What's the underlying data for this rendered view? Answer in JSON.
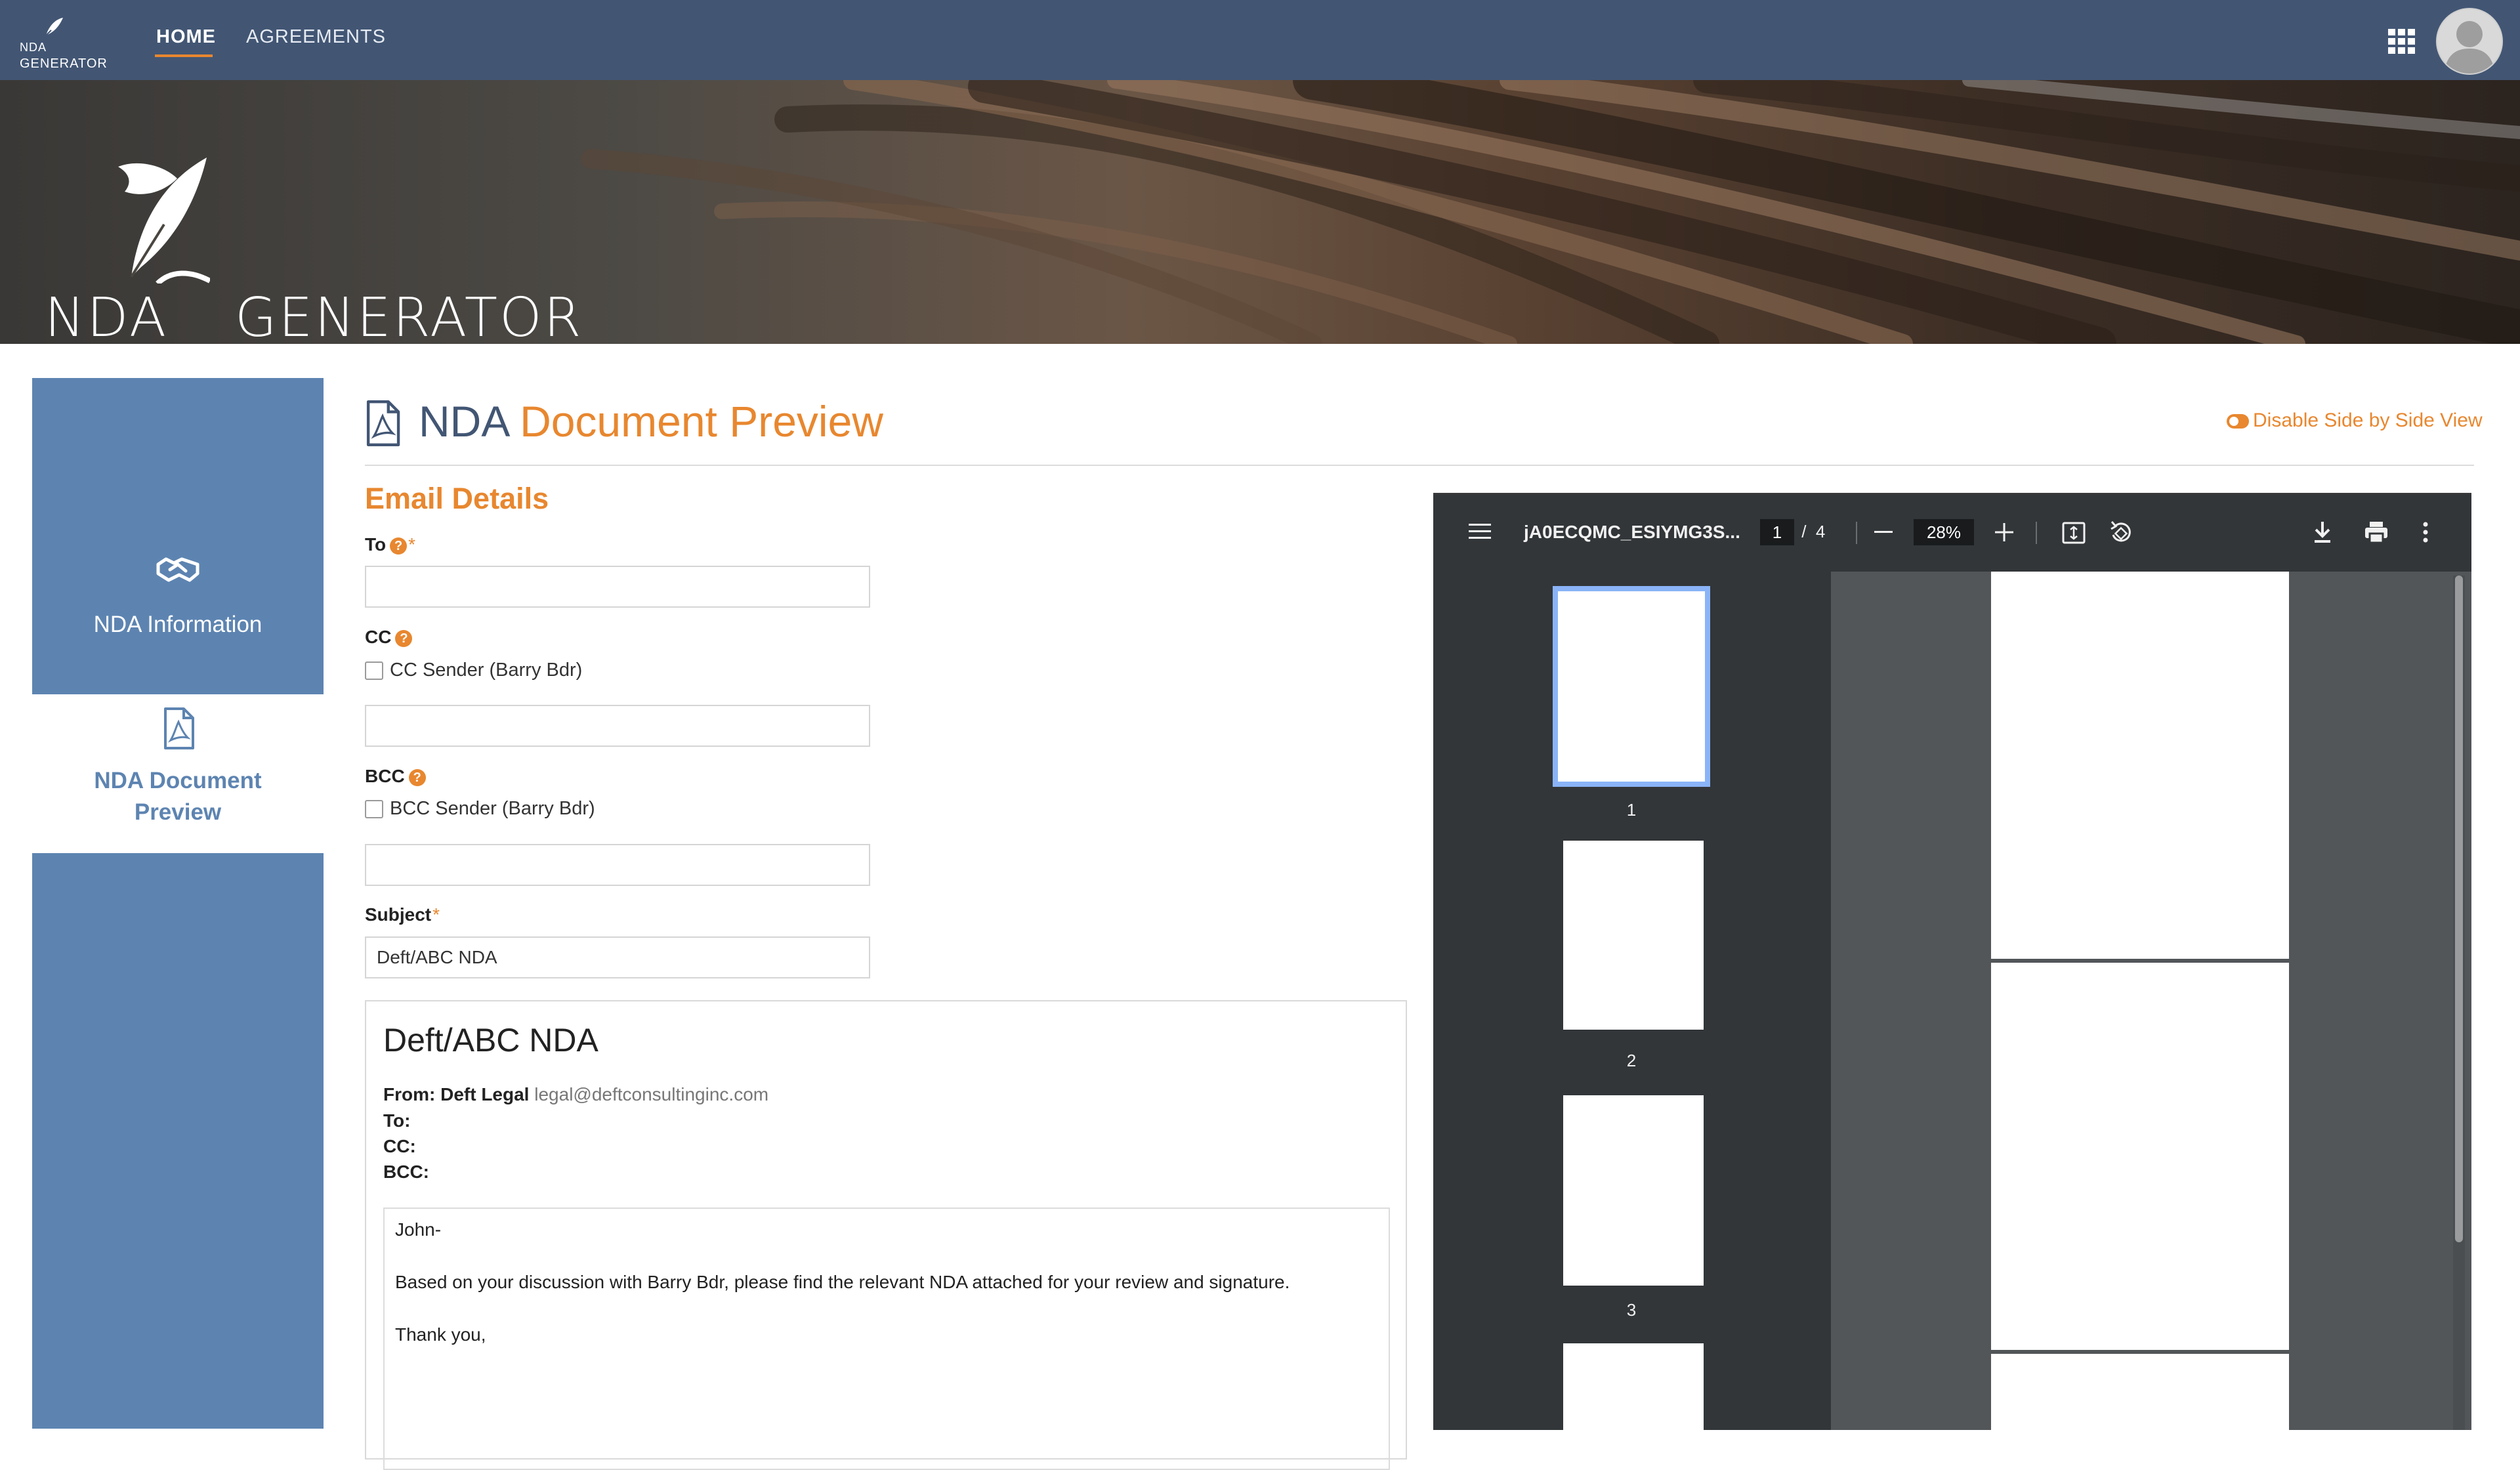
{
  "nav": {
    "logo_line1": "NDA",
    "logo_line2": "GENERATOR",
    "links": [
      {
        "label": "HOME"
      },
      {
        "label": "AGREEMENTS"
      }
    ]
  },
  "banner": {
    "brand_left": "NDA",
    "brand_right": "GENERATOR"
  },
  "sidebar": {
    "items": [
      {
        "label": "NDA Information"
      },
      {
        "label": "NDA Document Preview"
      }
    ]
  },
  "page": {
    "title_part1": "NDA",
    "title_part2": "Document Preview",
    "toggle_label": "Disable Side by Side View"
  },
  "form": {
    "section_title": "Email Details",
    "to_label": "To",
    "to_value": "",
    "cc_label": "CC",
    "cc_checkbox_label": "CC Sender (Barry Bdr)",
    "cc_value": "",
    "bcc_label": "BCC",
    "bcc_checkbox_label": "BCC Sender (Barry Bdr)",
    "bcc_value": "",
    "subject_label": "Subject",
    "subject_value": "Deft/ABC NDA",
    "help_glyph": "?",
    "required_mark": "*"
  },
  "email_preview": {
    "title": "Deft/ABC NDA",
    "from_label": "From:",
    "from_name": "Deft Legal",
    "from_email": "legal@deftconsultinginc.com",
    "to_label": "To:",
    "cc_label": "CC:",
    "bcc_label": "BCC:",
    "body": {
      "greeting": "John-",
      "paragraph": "Based on your discussion with Barry Bdr, please find the relevant NDA attached for your review and signature.",
      "closing": "Thank you,"
    }
  },
  "pdf_viewer": {
    "file_name": "jA0ECQMC_ESIYMG3S...",
    "current_page": "1",
    "page_separator": "/",
    "total_pages": "4",
    "zoom": "28%",
    "thumbnails": [
      "1",
      "2",
      "3"
    ]
  },
  "colors": {
    "nav_bg": "#425674",
    "accent": "#e8872f",
    "sidebar_bg": "#5d84b1",
    "viewer_toolbar": "#323639",
    "viewer_bg": "#525659"
  }
}
